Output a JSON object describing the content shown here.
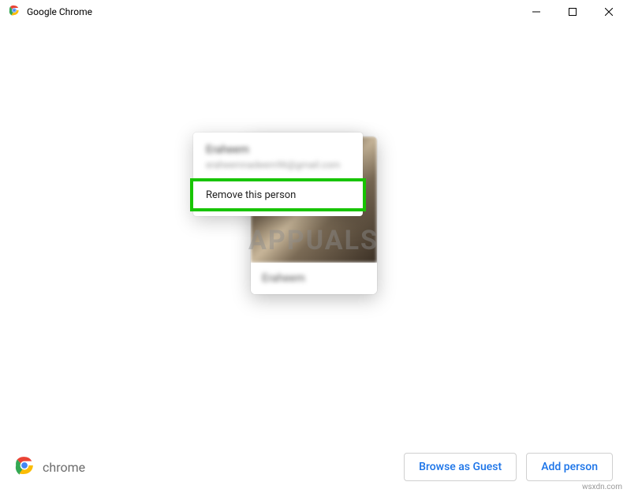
{
  "titlebar": {
    "title": "Google Chrome"
  },
  "profile_card": {
    "display_name": "Eraheem"
  },
  "context_menu": {
    "name": "Eraheem",
    "email": "eraheemnadeem96@gmail.com",
    "remove_label": "Remove this person"
  },
  "watermark": "APPUALS",
  "footer": {
    "brand": "chrome",
    "browse_guest": "Browse as Guest",
    "add_person": "Add person"
  },
  "attribution": "wsxdn.com"
}
